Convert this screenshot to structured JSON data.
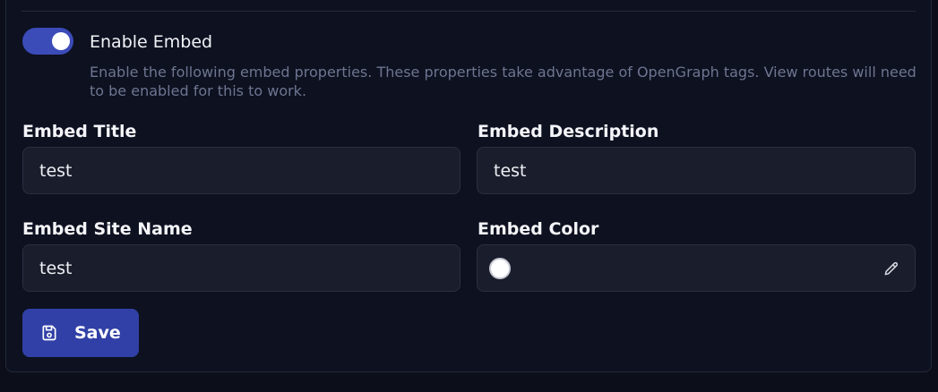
{
  "embed": {
    "toggle_label": "Enable Embed",
    "toggle_enabled": true,
    "description": "Enable the following embed properties. These properties take advantage of OpenGraph tags. View routes will need to be enabled for this to work."
  },
  "fields": {
    "title": {
      "label": "Embed Title",
      "value": "test"
    },
    "description": {
      "label": "Embed Description",
      "value": "test"
    },
    "site_name": {
      "label": "Embed Site Name",
      "value": "test"
    },
    "color": {
      "label": "Embed Color",
      "value": "",
      "swatch": "#ffffff"
    }
  },
  "actions": {
    "save_label": "Save"
  },
  "colors": {
    "accent": "#3b4bb8",
    "button": "#3140a6",
    "background": "#0c0f1a",
    "input": "#1a1d2b"
  },
  "icons": {
    "save": "floppy-disk-icon",
    "color_picker": "eyedropper-icon"
  }
}
